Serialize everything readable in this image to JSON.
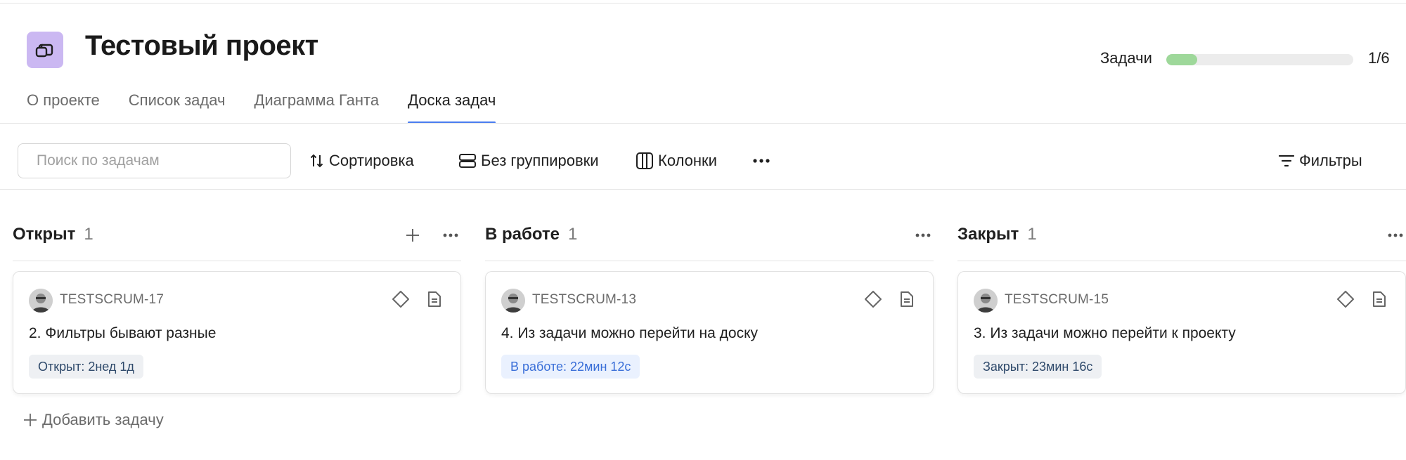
{
  "project": {
    "title": "Тестовый проект",
    "icon": "folder-stack-icon",
    "accent": "#cbb8f2"
  },
  "progress": {
    "label": "Задачи",
    "count": "1/6",
    "fraction": 0.167,
    "color": "#9ed89a"
  },
  "tabs": [
    {
      "label": "О проекте"
    },
    {
      "label": "Список задач"
    },
    {
      "label": "Диаграмма Ганта"
    },
    {
      "label": "Доска задач",
      "active": true
    }
  ],
  "toolbar": {
    "search_placeholder": "Поиск по задачам",
    "sort_label": "Сортировка",
    "group_label": "Без группировки",
    "columns_label": "Колонки",
    "filters_label": "Фильтры"
  },
  "columns": [
    {
      "title": "Открыт",
      "count": "1",
      "card": {
        "key": "TESTSCRUM-17",
        "title": "2. Фильтры бывают разные",
        "status": "Открыт: 2нед 1д",
        "status_bg": "#eef0f3",
        "status_fg": "#2f4a6b"
      }
    },
    {
      "title": "В работе",
      "count": "1",
      "card": {
        "key": "TESTSCRUM-13",
        "title": "4. Из задачи можно перейти на доску",
        "status": "В работе: 22мин 12с",
        "status_bg": "#eaf1fe",
        "status_fg": "#3a6fd8"
      }
    },
    {
      "title": "Закрыт",
      "count": "1",
      "card": {
        "key": "TESTSCRUM-15",
        "title": "3. Из задачи можно перейти к проекту",
        "status": "Закрыт: 23мин 16с",
        "status_bg": "#eef0f3",
        "status_fg": "#2f4a6b"
      }
    }
  ],
  "add_task_label": "Добавить задачу"
}
